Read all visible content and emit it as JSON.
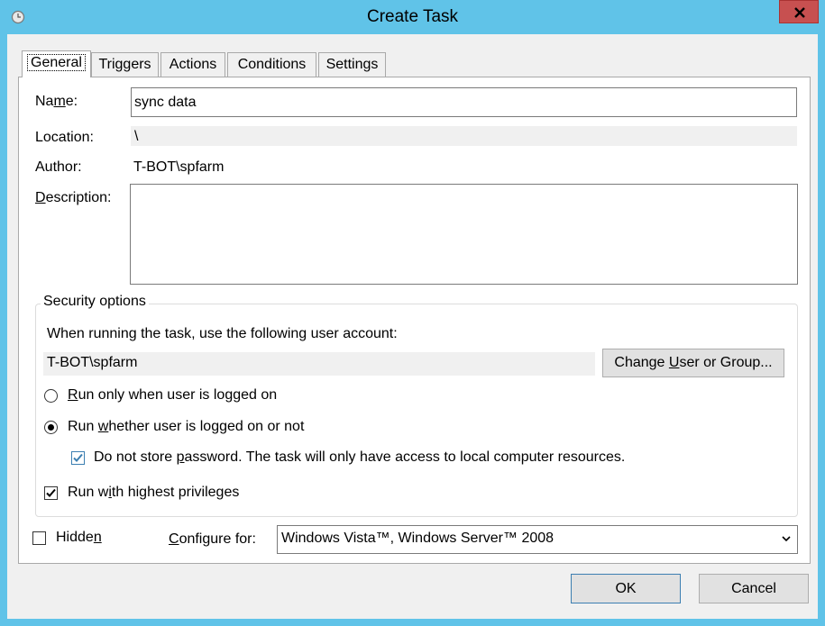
{
  "window": {
    "title": "Create Task"
  },
  "tabs": [
    {
      "label": "General",
      "active": true
    },
    {
      "label": "Triggers",
      "active": false
    },
    {
      "label": "Actions",
      "active": false
    },
    {
      "label": "Conditions",
      "active": false
    },
    {
      "label": "Settings",
      "active": false
    }
  ],
  "general": {
    "name_label_pre": "Na",
    "name_label_u": "m",
    "name_label_post": "e:",
    "name_value": "sync data",
    "location_label": "Location:",
    "location_value": "\\",
    "author_label": "Author:",
    "author_value": "T-BOT\\spfarm",
    "description_label_u": "D",
    "description_label_post": "escription:",
    "description_value": ""
  },
  "security": {
    "group_title": "Security options",
    "account_prompt": "When running the task, use the following user account:",
    "account_value": "T-BOT\\spfarm",
    "change_button_pre": "Change ",
    "change_button_u": "U",
    "change_button_post": "ser or Group...",
    "radio1_u": "R",
    "radio1_post": "un only when user is logged on",
    "radio1_selected": false,
    "radio2_pre": "Run ",
    "radio2_u": "w",
    "radio2_post": "hether user is logged on or not",
    "radio2_selected": true,
    "no_store_pre": "Do not store ",
    "no_store_u": "p",
    "no_store_post": "assword.  The task will only have access to local computer resources.",
    "no_store_checked": true,
    "highest_pre": "Run w",
    "highest_u": "i",
    "highest_post": "th highest privileges",
    "highest_checked": true
  },
  "bottom": {
    "hidden_pre": "Hidde",
    "hidden_u": "n",
    "hidden_checked": false,
    "configure_u": "C",
    "configure_post": "onfigure for:",
    "configure_value": "Windows Vista™, Windows Server™ 2008"
  },
  "buttons": {
    "ok": "OK",
    "cancel": "Cancel"
  },
  "colors": {
    "titlebar": "#60c3e8",
    "close": "#c75050",
    "check_accent": "#3c7fb1"
  }
}
